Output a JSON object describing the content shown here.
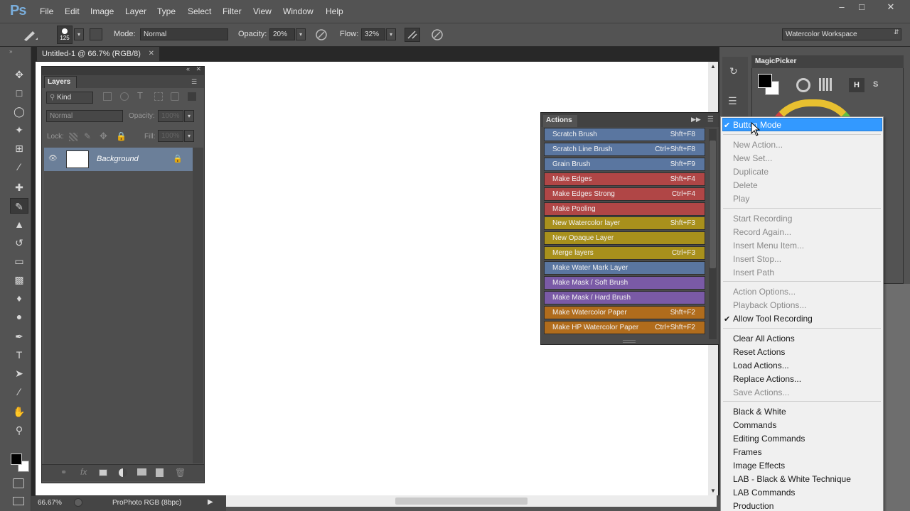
{
  "menubar": {
    "logo": "Ps",
    "items": [
      "File",
      "Edit",
      "Image",
      "Layer",
      "Type",
      "Select",
      "Filter",
      "View",
      "Window",
      "Help"
    ]
  },
  "options": {
    "brush_size": "125",
    "mode_label": "Mode:",
    "mode_value": "Normal",
    "opacity_label": "Opacity:",
    "opacity_value": "20%",
    "flow_label": "Flow:",
    "flow_value": "32%",
    "workspace": "Watercolor Workspace"
  },
  "document": {
    "tab_title": "Untitled-1 @ 66.7% (RGB/8)",
    "zoom": "66.67%",
    "profile": "ProPhoto RGB (8bpc)"
  },
  "layers": {
    "tab": "Layers",
    "kind_label": "Kind",
    "blend_mode": "Normal",
    "opacity_label": "Opacity:",
    "opacity_value": "100%",
    "lock_label": "Lock:",
    "fill_label": "Fill:",
    "fill_value": "100%",
    "layer_name": "Background"
  },
  "actions": {
    "tab": "Actions",
    "items": [
      {
        "name": "Scratch Brush",
        "shortcut": "Shft+F8",
        "color": "#5a76a0"
      },
      {
        "name": "Scratch Line Brush",
        "shortcut": "Ctrl+Shft+F8",
        "color": "#5a76a0"
      },
      {
        "name": "Grain Brush",
        "shortcut": "Shft+F9",
        "color": "#5a76a0"
      },
      {
        "name": "Make Edges",
        "shortcut": "Shft+F4",
        "color": "#b04646"
      },
      {
        "name": "Make Edges Strong",
        "shortcut": "Ctrl+F4",
        "color": "#b04646"
      },
      {
        "name": "Make Pooling",
        "shortcut": "",
        "color": "#b04646"
      },
      {
        "name": "New Watercolor layer",
        "shortcut": "Shft+F3",
        "color": "#a8901c"
      },
      {
        "name": "New Opaque Layer",
        "shortcut": "",
        "color": "#a8901c"
      },
      {
        "name": "Merge layers",
        "shortcut": "Ctrl+F3",
        "color": "#a8901c"
      },
      {
        "name": "Make Water Mark Layer",
        "shortcut": "",
        "color": "#5a76a0"
      },
      {
        "name": "Make Mask / Soft Brush",
        "shortcut": "",
        "color": "#7a5aa6"
      },
      {
        "name": "Make Mask / Hard Brush",
        "shortcut": "",
        "color": "#7a5aa6"
      },
      {
        "name": "Make Watercolor Paper",
        "shortcut": "Shft+F2",
        "color": "#b06c1c"
      },
      {
        "name": "Make HP Watercolor Paper",
        "shortcut": "Ctrl+Shft+F2",
        "color": "#b06c1c"
      }
    ]
  },
  "magicpicker": {
    "title": "MagicPicker",
    "h_label": "H",
    "s_label": "S"
  },
  "flyout": {
    "items": [
      {
        "label": "Button Mode",
        "checked": true,
        "disabled": false,
        "highlight": true
      },
      {
        "label": "New Action...",
        "disabled": true
      },
      {
        "label": "New Set...",
        "disabled": true
      },
      {
        "label": "Duplicate",
        "disabled": true
      },
      {
        "label": "Delete",
        "disabled": true
      },
      {
        "label": "Play",
        "disabled": true
      },
      {
        "label": "Start Recording",
        "disabled": true
      },
      {
        "label": "Record Again...",
        "disabled": true
      },
      {
        "label": "Insert Menu Item...",
        "disabled": true
      },
      {
        "label": "Insert Stop...",
        "disabled": true
      },
      {
        "label": "Insert Path",
        "disabled": true
      },
      {
        "label": "Action Options...",
        "disabled": true
      },
      {
        "label": "Playback Options...",
        "disabled": true
      },
      {
        "label": "Allow Tool Recording",
        "checked": true,
        "disabled": false
      },
      {
        "label": "Clear All Actions",
        "disabled": false
      },
      {
        "label": "Reset Actions",
        "disabled": false
      },
      {
        "label": "Load Actions...",
        "disabled": false
      },
      {
        "label": "Replace Actions...",
        "disabled": false
      },
      {
        "label": "Save Actions...",
        "disabled": true
      },
      {
        "label": "Black & White",
        "disabled": false
      },
      {
        "label": "Commands",
        "disabled": false
      },
      {
        "label": "Editing Commands",
        "disabled": false
      },
      {
        "label": "Frames",
        "disabled": false
      },
      {
        "label": "Image Effects",
        "disabled": false
      },
      {
        "label": "LAB - Black & White Technique",
        "disabled": false
      },
      {
        "label": "LAB Commands",
        "disabled": false
      },
      {
        "label": "Production",
        "disabled": false
      }
    ]
  },
  "colors": {
    "menu_highlight": "#3399ff",
    "panel_bg": "#535353",
    "layer_selected": "#6b7f99"
  }
}
